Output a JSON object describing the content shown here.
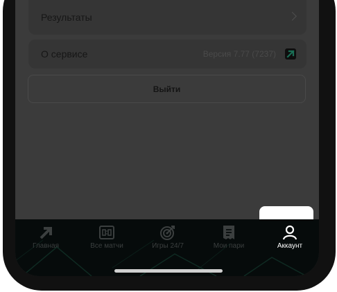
{
  "menu": {
    "results_label": "Результаты",
    "about_label": "О сервисе",
    "version_text": "Версия 7.77 (7237)"
  },
  "logout_label": "Выйти",
  "tabbar": {
    "tabs": [
      {
        "label": "Главная",
        "icon": "logo-arrow-icon"
      },
      {
        "label": "Все матчи",
        "icon": "scoreboard-icon"
      },
      {
        "label": "Игры 24/7",
        "icon": "target-icon"
      },
      {
        "label": "Мои пари",
        "icon": "receipt-icon"
      },
      {
        "label": "Аккаунт",
        "icon": "user-icon"
      }
    ],
    "active_index": 4
  },
  "colors": {
    "overlay": "#3b3b3b",
    "tabbar_bg": "#060b0b",
    "accent": "#2fd1a0"
  }
}
